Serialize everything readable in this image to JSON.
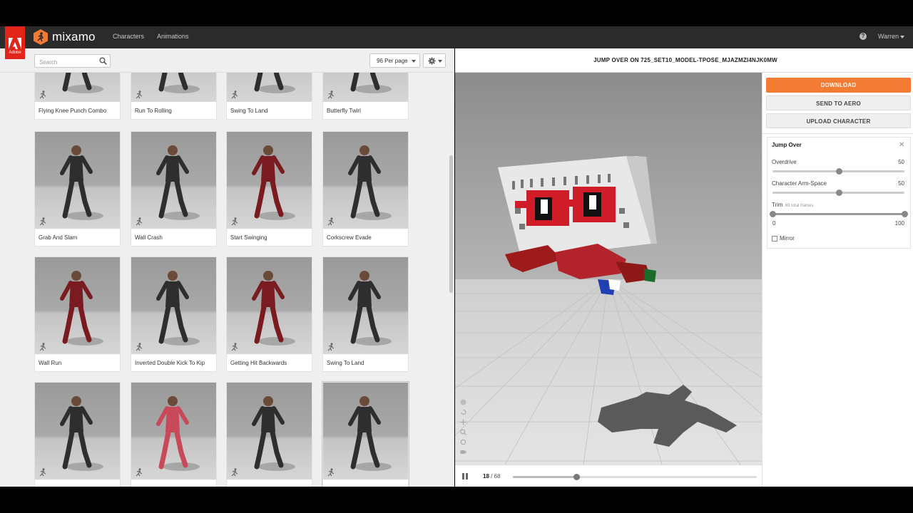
{
  "header": {
    "adobe_label": "Adobe",
    "brand": "mixamo",
    "nav": {
      "characters": "Characters",
      "animations": "Animations"
    },
    "help": "?",
    "user": "Warren"
  },
  "toolbar": {
    "search_placeholder": "Search",
    "per_page": "96 Per page"
  },
  "animations": [
    {
      "name": "Flying Knee Punch Combo"
    },
    {
      "name": "Run To Rolling"
    },
    {
      "name": "Swing To Land"
    },
    {
      "name": "Butterfly Twirl"
    },
    {
      "name": "Grab And Slam"
    },
    {
      "name": "Wall Crash"
    },
    {
      "name": "Start Swinging"
    },
    {
      "name": "Corkscrew Evade"
    },
    {
      "name": "Wall Run"
    },
    {
      "name": "Inverted Double Kick To Kip"
    },
    {
      "name": "Getting Hit Backwards"
    },
    {
      "name": "Swing To Land"
    },
    {
      "name": ""
    },
    {
      "name": ""
    },
    {
      "name": ""
    },
    {
      "name": ""
    }
  ],
  "viewer": {
    "title": "JUMP OVER ON 725_SET10_MODEL-TPOSE_MJAZMZI4NJK0MW",
    "current_frame": "18",
    "frame_sep": " / ",
    "total_frames": "68",
    "progress": 0.26
  },
  "actions": {
    "download": "DOWNLOAD",
    "send_to_aero": "SEND TO AERO",
    "upload_character": "UPLOAD CHARACTER",
    "download_color": "#f47b34"
  },
  "settings": {
    "title": "Jump Over",
    "close": "✕",
    "overdrive": {
      "label": "Overdrive",
      "value": "50",
      "fraction": 0.5
    },
    "arm_space": {
      "label": "Character Arm-Space",
      "value": "50",
      "fraction": 0.5
    },
    "trim": {
      "label": "Trim",
      "sub": "69 total frames",
      "min": "0",
      "max": "100"
    },
    "mirror": "Mirror"
  }
}
